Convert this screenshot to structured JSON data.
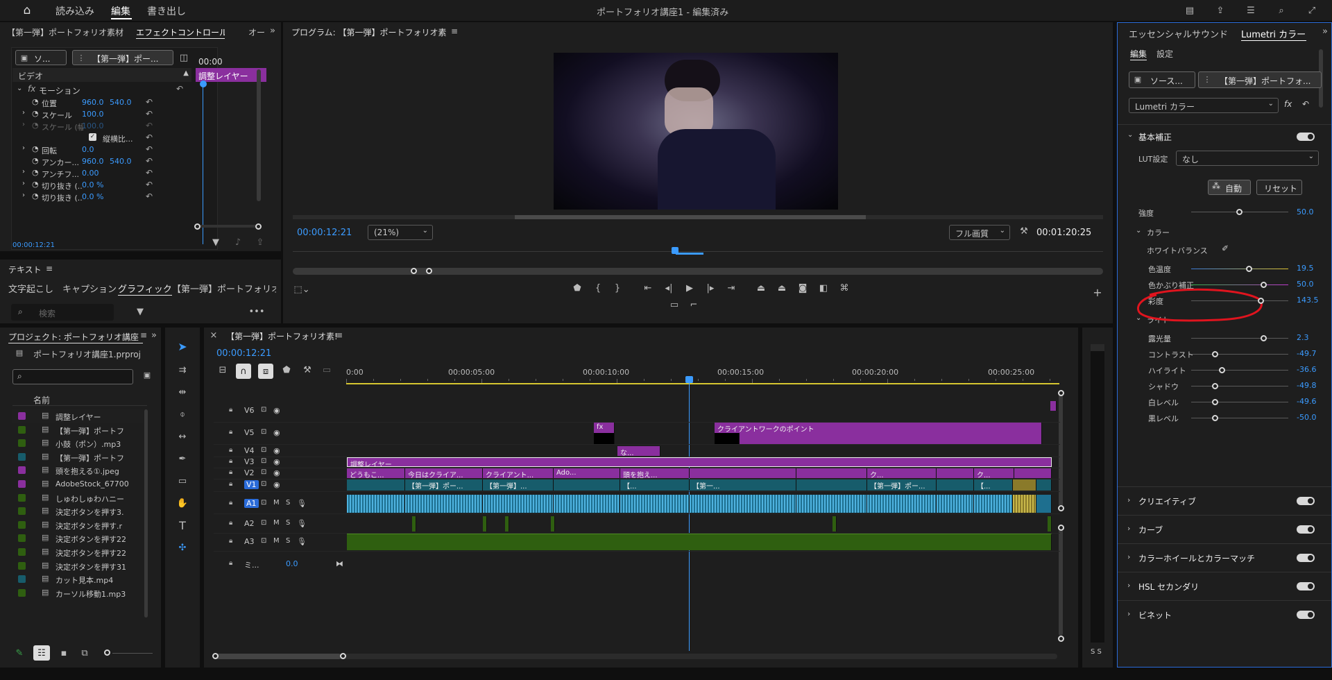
{
  "topbar": {
    "home": "⌂",
    "import": "読み込み",
    "edit": "編集",
    "export": "書き出し",
    "title": "ポートフォリオ講座1 - 編集済み"
  },
  "effect_controls": {
    "tab_source": "【第一弾】ポートフォリオ素材",
    "tab_active": "エフェクトコントロール",
    "tab_more": "オー",
    "source_btn": "ソ...",
    "seq_btn": "【第一弾】ポー...",
    "timecode_top": "00:00",
    "video": "ビデオ",
    "motion": "モーション",
    "clip_label": "調整レイヤー",
    "rows": [
      {
        "label": "位置",
        "v1": "960.0",
        "v2": "540.0"
      },
      {
        "label": "スケール",
        "v1": "100.0",
        "v2": ""
      },
      {
        "label": "スケール (幅)",
        "v1": "100.0",
        "v2": ""
      },
      {
        "label": "縦横比...",
        "v1": "",
        "v2": ""
      },
      {
        "label": "回転",
        "v1": "0.0",
        "v2": ""
      },
      {
        "label": "アンカー...",
        "v1": "960.0",
        "v2": "540.0"
      },
      {
        "label": "アンチフ...",
        "v1": "0.00",
        "v2": ""
      },
      {
        "label": "切り抜き (...",
        "v1": "0.0 %",
        "v2": ""
      },
      {
        "label": "切り抜き (...",
        "v1": "0.0 %",
        "v2": ""
      }
    ],
    "timecode": "00:00:12:21"
  },
  "text_panel": {
    "title": "テキスト",
    "tabs": [
      "文字起こし",
      "キャプション",
      "グラフィック",
      "【第一弾】ポートフォリオ..."
    ],
    "search_placeholder": "検索"
  },
  "program": {
    "title": "プログラム: 【第一弾】ポートフォリオ素",
    "timecode": "00:00:12:21",
    "zoom": "(21%)",
    "quality": "フル画質",
    "duration": "00:01:20:25"
  },
  "project": {
    "title": "プロジェクト: ポートフォリオ講座",
    "file": "ポートフォリオ講座1.prproj",
    "name_col": "名前",
    "items": [
      {
        "name": "調整レイヤー",
        "color": "#8a2f9e"
      },
      {
        "name": "【第一弾】ポートフ",
        "color": "#2f5f10"
      },
      {
        "name": "小鼓（ポン）.mp3",
        "color": "#2f5f10"
      },
      {
        "name": "【第一弾】ポートフ",
        "color": "#175c6b"
      },
      {
        "name": "頭を抱える①.jpeg",
        "color": "#8a2f9e"
      },
      {
        "name": "AdobeStock_67700",
        "color": "#8a2f9e"
      },
      {
        "name": "しゅわしゅわハニー",
        "color": "#2f5f10"
      },
      {
        "name": "決定ボタンを押す3.",
        "color": "#2f5f10"
      },
      {
        "name": "決定ボタンを押す.r",
        "color": "#2f5f10"
      },
      {
        "name": "決定ボタンを押す22",
        "color": "#2f5f10"
      },
      {
        "name": "決定ボタンを押す22",
        "color": "#2f5f10"
      },
      {
        "name": "決定ボタンを押す31",
        "color": "#2f5f10"
      },
      {
        "name": "カット見本.mp4",
        "color": "#175c6b"
      },
      {
        "name": "カーソル移動1.mp3",
        "color": "#2f5f10"
      }
    ]
  },
  "timeline": {
    "title": "【第一弾】ポートフォリオ素!",
    "timecode": "00:00:12:21",
    "ruler": [
      "0:00",
      "00:00:05:00",
      "00:00:10:00",
      "00:00:15:00",
      "00:00:20:00",
      "00:00:25:00"
    ],
    "tracks": [
      "V6",
      "V5",
      "V4",
      "V3",
      "V2",
      "V1",
      "A1",
      "A2",
      "A3"
    ],
    "mix": "ミ...",
    "mix_val": "0.0",
    "clips": {
      "v5a": "fx",
      "v5b": "クライアントワークのポイント",
      "v4": "な...",
      "v3": "調整レイヤー",
      "v2": [
        "どうもこ...",
        "今日はクライア...",
        "クライアント...",
        "Ado...",
        "頭を抱え...",
        "ク...",
        "ク..."
      ],
      "v1": [
        "【第一弾】ポー...",
        "【第一弾】...",
        "【...",
        "【第一...",
        "【第一弾】ポー...",
        "【..."
      ]
    }
  },
  "lumetri": {
    "tab1": "エッセンシャルサウンド",
    "tab2": "Lumetri カラー",
    "edit": "編集",
    "settings": "設定",
    "source_btn": "ソース...",
    "seq_btn": "【第一弾】ポートフォ...",
    "effect": "Lumetri カラー",
    "basic": "基本補正",
    "lut_label": "LUT設定",
    "lut_value": "なし",
    "auto": "自動",
    "reset": "リセット",
    "intensity": {
      "label": "強度",
      "value": "50.0",
      "pos": 0.5
    },
    "color_section": "カラー",
    "wb": "ホワイトバランス",
    "color_rows": [
      {
        "label": "色温度",
        "value": "19.5",
        "pos": 0.6
      },
      {
        "label": "色かぶり補正",
        "value": "50.0",
        "pos": 0.75
      },
      {
        "label": "彩度",
        "value": "143.5",
        "pos": 0.72
      }
    ],
    "light_section": "ライト",
    "light_rows": [
      {
        "label": "露光量",
        "value": "2.3",
        "pos": 0.75
      },
      {
        "label": "コントラスト",
        "value": "-49.7",
        "pos": 0.25
      },
      {
        "label": "ハイライト",
        "value": "-36.6",
        "pos": 0.32
      },
      {
        "label": "シャドウ",
        "value": "-49.8",
        "pos": 0.25
      },
      {
        "label": "白レベル",
        "value": "-49.6",
        "pos": 0.25
      },
      {
        "label": "黒レベル",
        "value": "-50.0",
        "pos": 0.25
      }
    ],
    "sections": [
      "クリエイティブ",
      "カーブ",
      "カラーホイールとカラーマッチ",
      "HSL セカンダリ",
      "ビネット"
    ]
  },
  "colors": {
    "accent": "#3b9bff",
    "purple": "#8a2f9e",
    "highlight_circle": "#e0141e"
  }
}
